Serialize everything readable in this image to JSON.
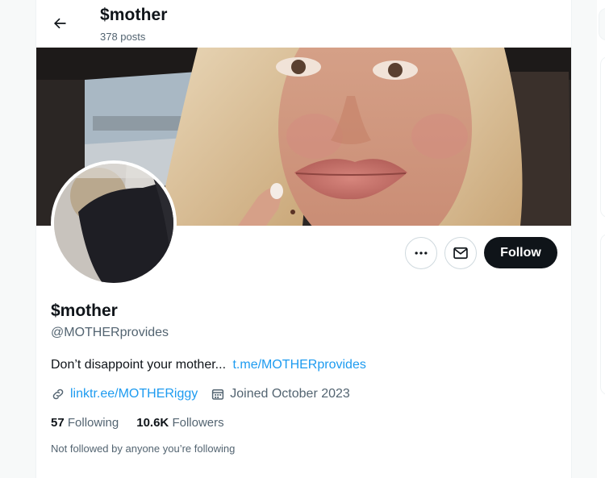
{
  "header": {
    "back_icon": "arrow-left-icon",
    "name": "$mother",
    "posts": "378 posts"
  },
  "profile": {
    "display_name": "$mother",
    "handle": "@MOTHERprovides",
    "bio_text": "Don’t disappoint your mother...",
    "bio_link": "t.me/MOTHERprovides",
    "website": "linktr.ee/MOTHERiggy",
    "joined": "Joined October 2023",
    "following_count": "57",
    "following_label": "Following",
    "followers_count": "10.6K",
    "followers_label": "Followers",
    "mutuals_note": "Not followed by anyone you’re following"
  },
  "actions": {
    "more_icon": "more-dots-icon",
    "message_icon": "envelope-icon",
    "follow_label": "Follow"
  },
  "icons": {
    "link": "link-icon",
    "calendar": "calendar-icon"
  },
  "colors": {
    "accent": "#1d9bf0",
    "text": "#0f1419",
    "muted": "#536471",
    "follow_bg": "#0f1419"
  }
}
